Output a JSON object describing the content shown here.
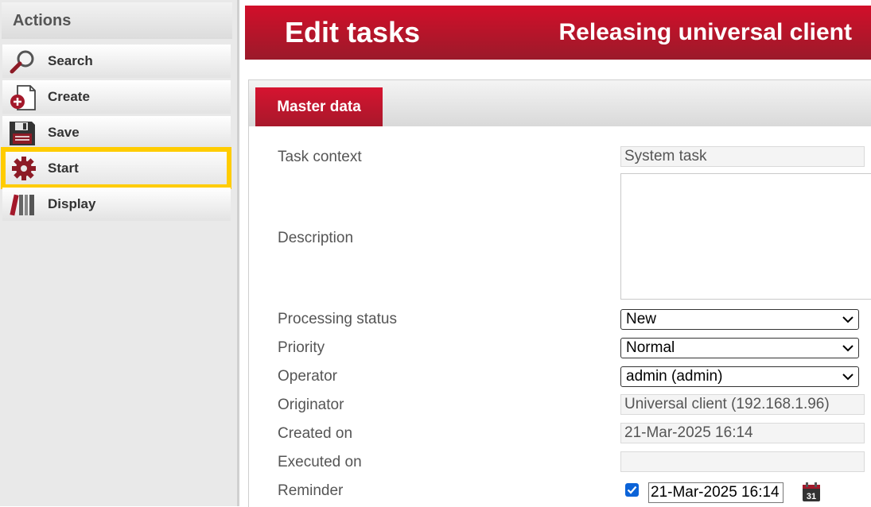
{
  "sidebar": {
    "header": "Actions",
    "items": [
      {
        "label": "Search",
        "icon": "search-icon"
      },
      {
        "label": "Create",
        "icon": "create-document-icon"
      },
      {
        "label": "Save",
        "icon": "save-icon"
      },
      {
        "label": "Start",
        "icon": "gear-icon"
      },
      {
        "label": "Display",
        "icon": "display-books-icon"
      }
    ],
    "highlighted": "Start",
    "highlight_color": "#ffcc00"
  },
  "header": {
    "title": "Edit tasks",
    "subtitle": "Releasing universal client",
    "brand_color": "#c8102e"
  },
  "tabs": [
    {
      "label": "Master data",
      "active": true
    }
  ],
  "form": {
    "task_context": {
      "label": "Task context",
      "value": "System task"
    },
    "description": {
      "label": "Description",
      "value": ""
    },
    "processing_status": {
      "label": "Processing status",
      "value": "New"
    },
    "priority": {
      "label": "Priority",
      "value": "Normal"
    },
    "operator": {
      "label": "Operator",
      "value": "admin (admin)"
    },
    "originator": {
      "label": "Originator",
      "value": "Universal client (192.168.1.96)"
    },
    "created_on": {
      "label": "Created on",
      "value": "21-Mar-2025 16:14"
    },
    "executed_on": {
      "label": "Executed on",
      "value": ""
    },
    "reminder": {
      "label": "Reminder",
      "checked": true,
      "value": "21-Mar-2025 16:14",
      "calendar_day": "31"
    }
  }
}
